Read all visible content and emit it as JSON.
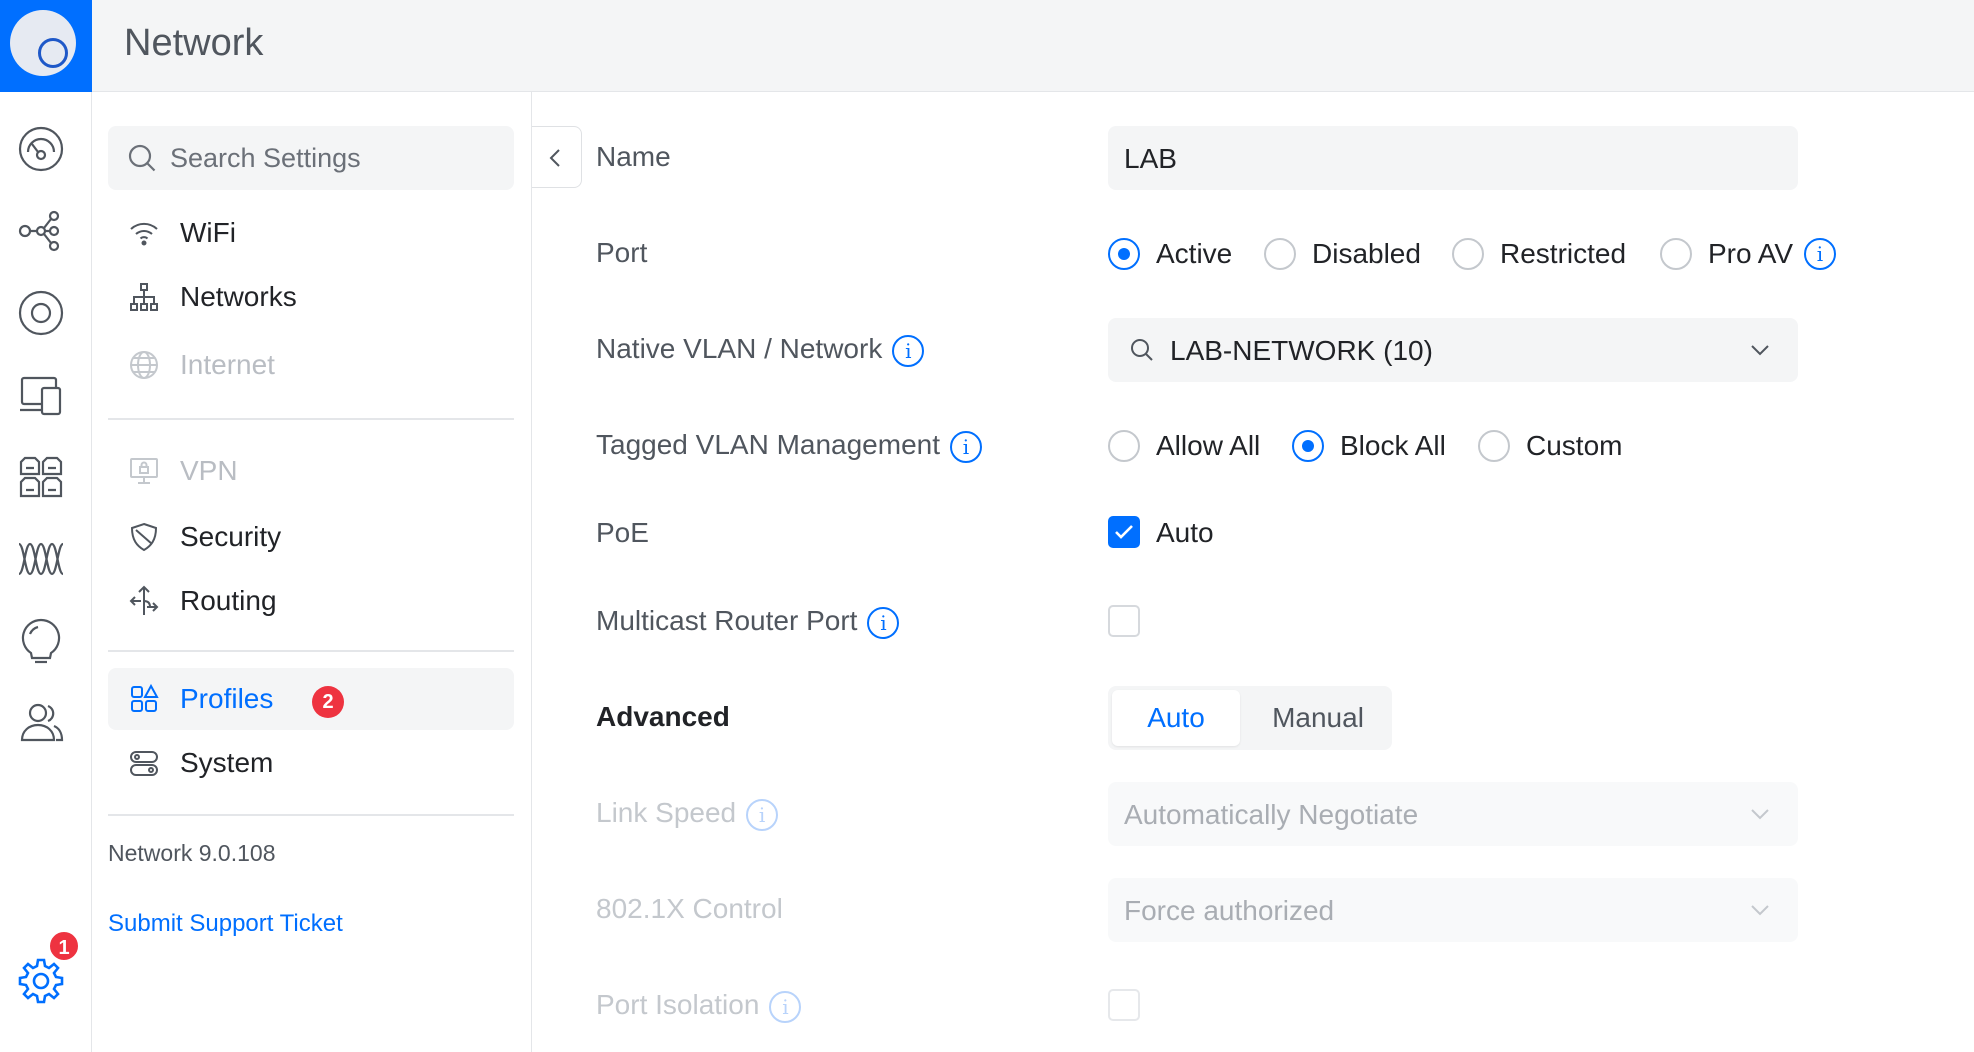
{
  "app": {
    "title": "Network"
  },
  "rail": {
    "items": [
      "dashboard-icon",
      "topology-icon",
      "devices-icon",
      "clients-icon",
      "ports-icon",
      "insights-icon",
      "alerts-icon",
      "admins-icon",
      "settings-icon"
    ],
    "settings_badge": "1"
  },
  "nav": {
    "search_placeholder": "Search Settings",
    "items": [
      {
        "label": "WiFi",
        "icon": "wifi-icon",
        "state": "normal"
      },
      {
        "label": "Networks",
        "icon": "networks-icon",
        "state": "normal"
      },
      {
        "label": "Internet",
        "icon": "globe-icon",
        "state": "disabled"
      },
      {
        "label": "VPN",
        "icon": "vpn-icon",
        "state": "disabled"
      },
      {
        "label": "Security",
        "icon": "shield-icon",
        "state": "normal"
      },
      {
        "label": "Routing",
        "icon": "routing-icon",
        "state": "normal"
      },
      {
        "label": "Profiles",
        "icon": "profiles-icon",
        "state": "active",
        "badge": "2"
      },
      {
        "label": "System",
        "icon": "system-icon",
        "state": "normal"
      }
    ],
    "version": "Network 9.0.108",
    "support_link": "Submit Support Ticket"
  },
  "form": {
    "name": {
      "label": "Name",
      "value": "LAB"
    },
    "port": {
      "label": "Port",
      "options": [
        "Active",
        "Disabled",
        "Restricted",
        "Pro AV"
      ],
      "selected": "Active"
    },
    "native_vlan": {
      "label": "Native VLAN / Network",
      "value": "LAB-NETWORK (10)"
    },
    "tagged_vlan": {
      "label": "Tagged VLAN Management",
      "options": [
        "Allow All",
        "Block All",
        "Custom"
      ],
      "selected": "Block All"
    },
    "poe": {
      "label": "PoE",
      "option": "Auto",
      "checked": true
    },
    "multicast": {
      "label": "Multicast Router Port",
      "checked": false
    },
    "advanced": {
      "label": "Advanced",
      "options": [
        "Auto",
        "Manual"
      ],
      "selected": "Auto"
    },
    "link_speed": {
      "label": "Link Speed",
      "value": "Automatically Negotiate"
    },
    "dot1x": {
      "label": "802.1X Control",
      "value": "Force authorized"
    },
    "port_isolation": {
      "label": "Port Isolation",
      "checked": false
    }
  },
  "colors": {
    "accent": "#006fff",
    "badge": "#ee3340"
  }
}
